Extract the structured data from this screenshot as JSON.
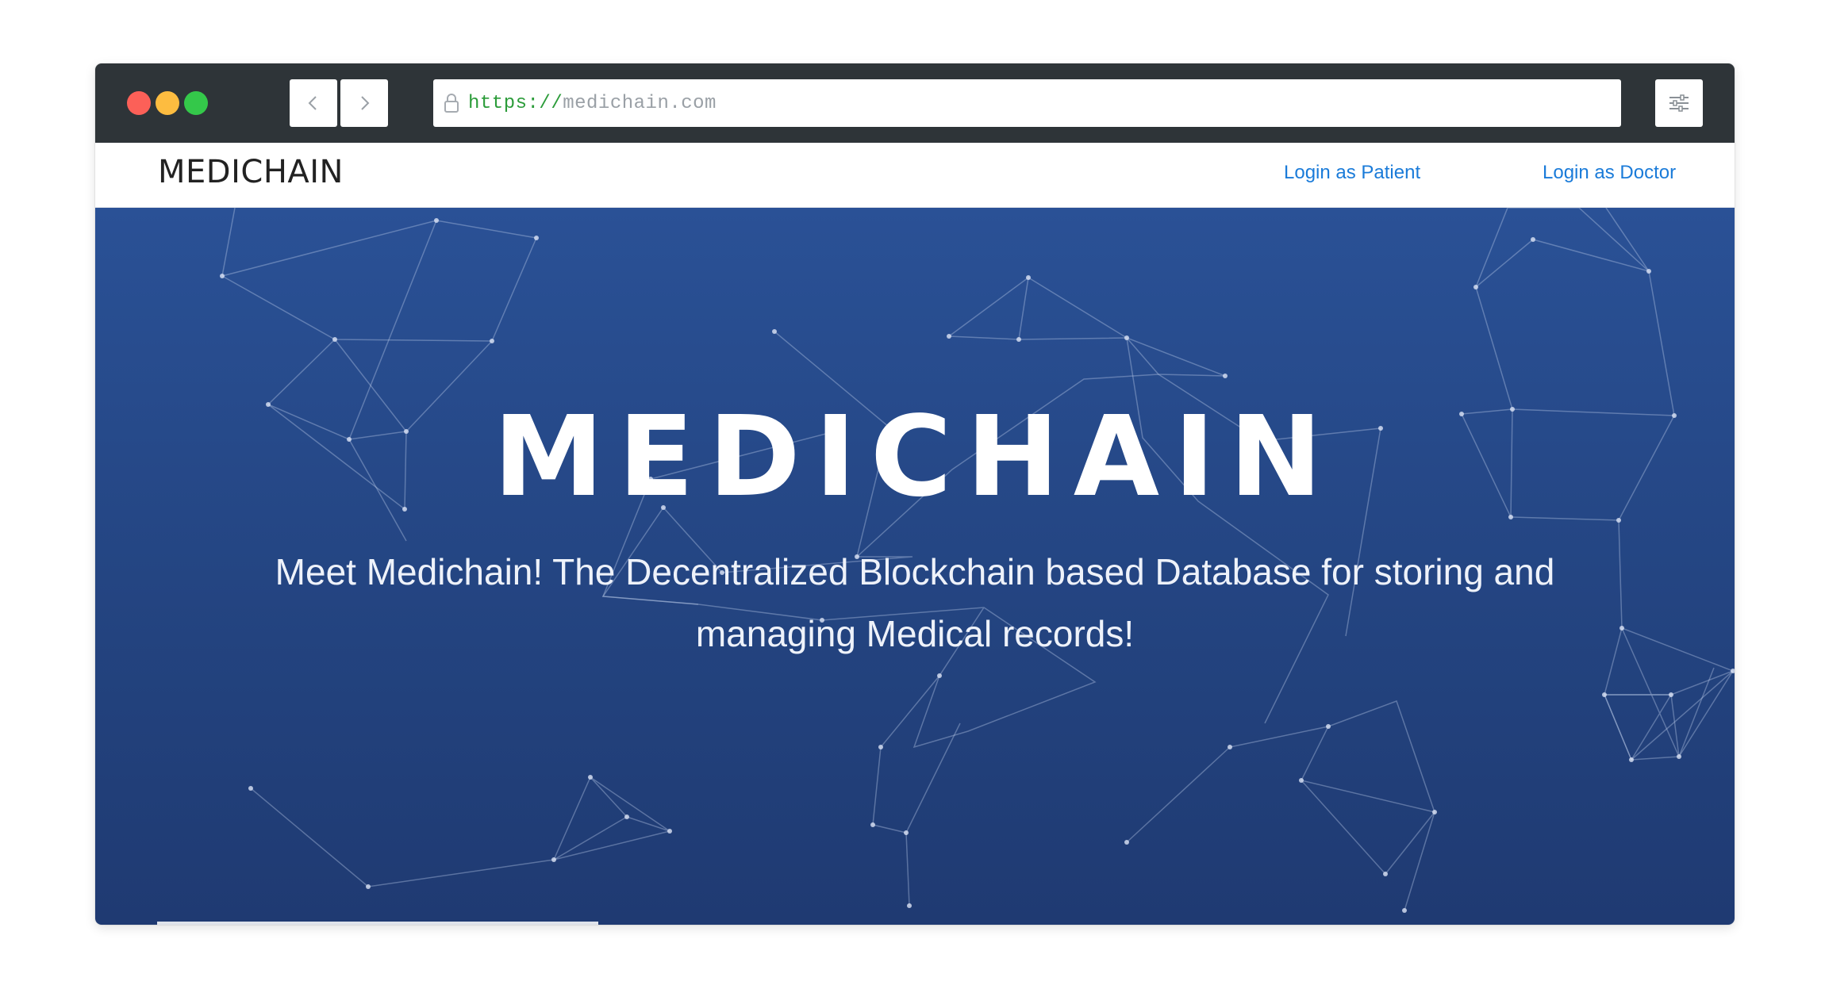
{
  "browser": {
    "url_scheme": "https://",
    "url_host": "medichain.com",
    "icons": {
      "back": "chevron-left-icon",
      "forward": "chevron-right-icon",
      "lock": "lock-icon",
      "settings": "sliders-icon"
    },
    "traffic_colors": [
      "#fc6058",
      "#fdbc40",
      "#34c84a"
    ]
  },
  "navbar": {
    "brand": "MEDICHAIN",
    "links": [
      {
        "label": "Login as Patient"
      },
      {
        "label": "Login as Doctor"
      }
    ],
    "link_color": "#1a7bd9"
  },
  "hero": {
    "title": "MEDICHAIN",
    "subtitle": "Meet Medichain! The Decentralized Blockchain based Database for storing and managing Medical records!",
    "background": "#24457f"
  }
}
